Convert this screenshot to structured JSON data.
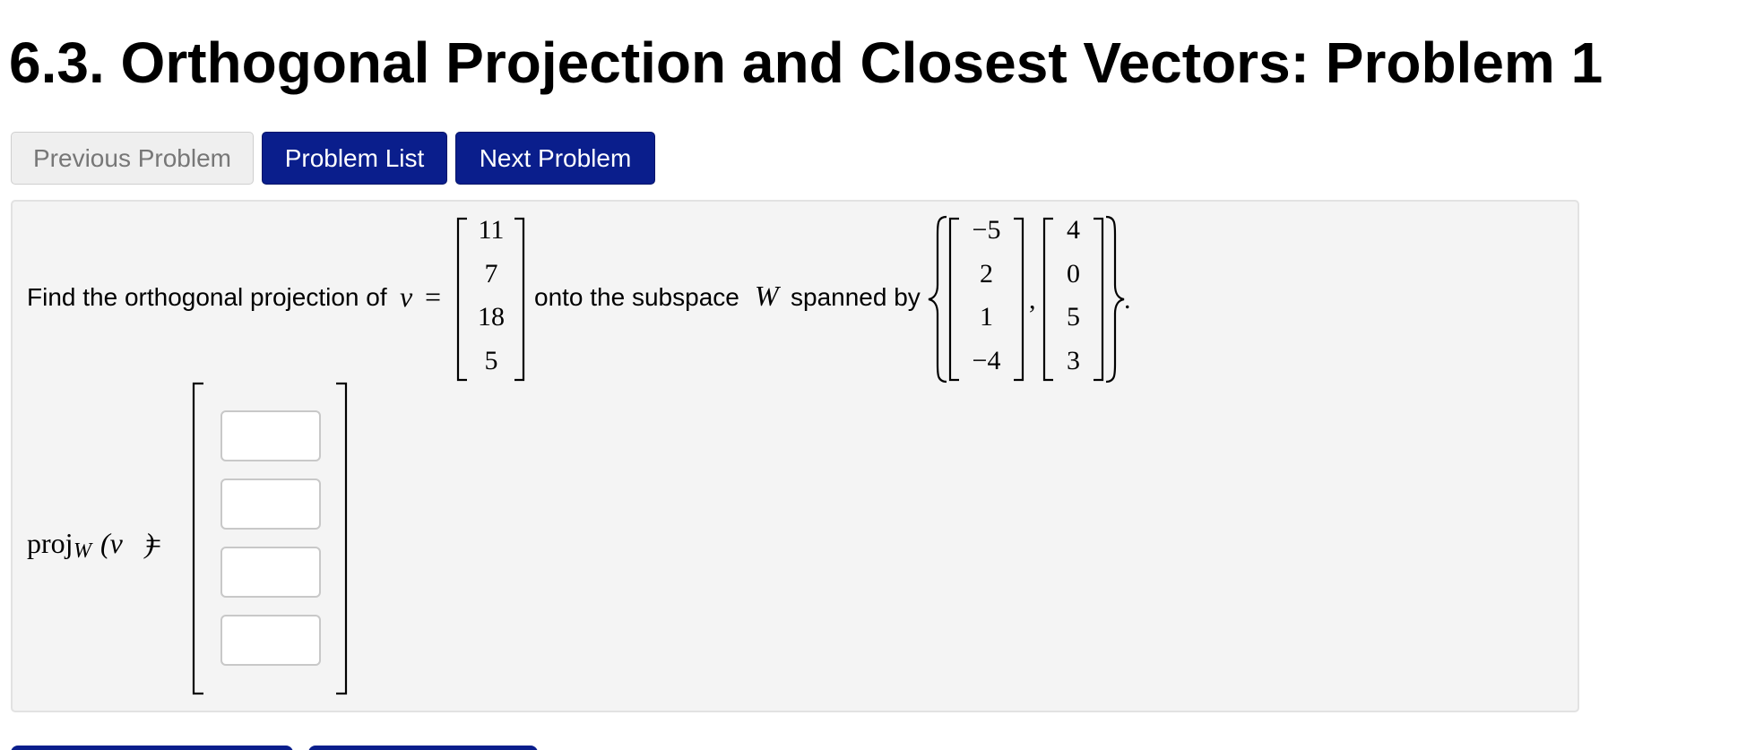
{
  "page": {
    "title": "6.3. Orthogonal Projection and Closest Vectors: Problem 1"
  },
  "nav": {
    "previous_label": "Previous Problem",
    "list_label": "Problem List",
    "next_label": "Next Problem"
  },
  "problem": {
    "prompt_start": "Find the orthogonal projection of",
    "vector_symbol": "v⃗",
    "equals": "=",
    "vector_v": [
      "11",
      "7",
      "18",
      "5"
    ],
    "prompt_middle": "onto the subspace",
    "subspace_symbol": "W",
    "prompt_end": "spanned by",
    "span_vector_1": [
      "−5",
      "2",
      "1",
      "−4"
    ],
    "comma": ",",
    "span_vector_2": [
      "4",
      "0",
      "5",
      "3"
    ],
    "period": ".",
    "answer_label_proj": "proj",
    "answer_label_sub": "W",
    "answer_label_arg": "(v⃗)",
    "answer_equals": "=",
    "answer_values": [
      "",
      "",
      "",
      ""
    ]
  }
}
